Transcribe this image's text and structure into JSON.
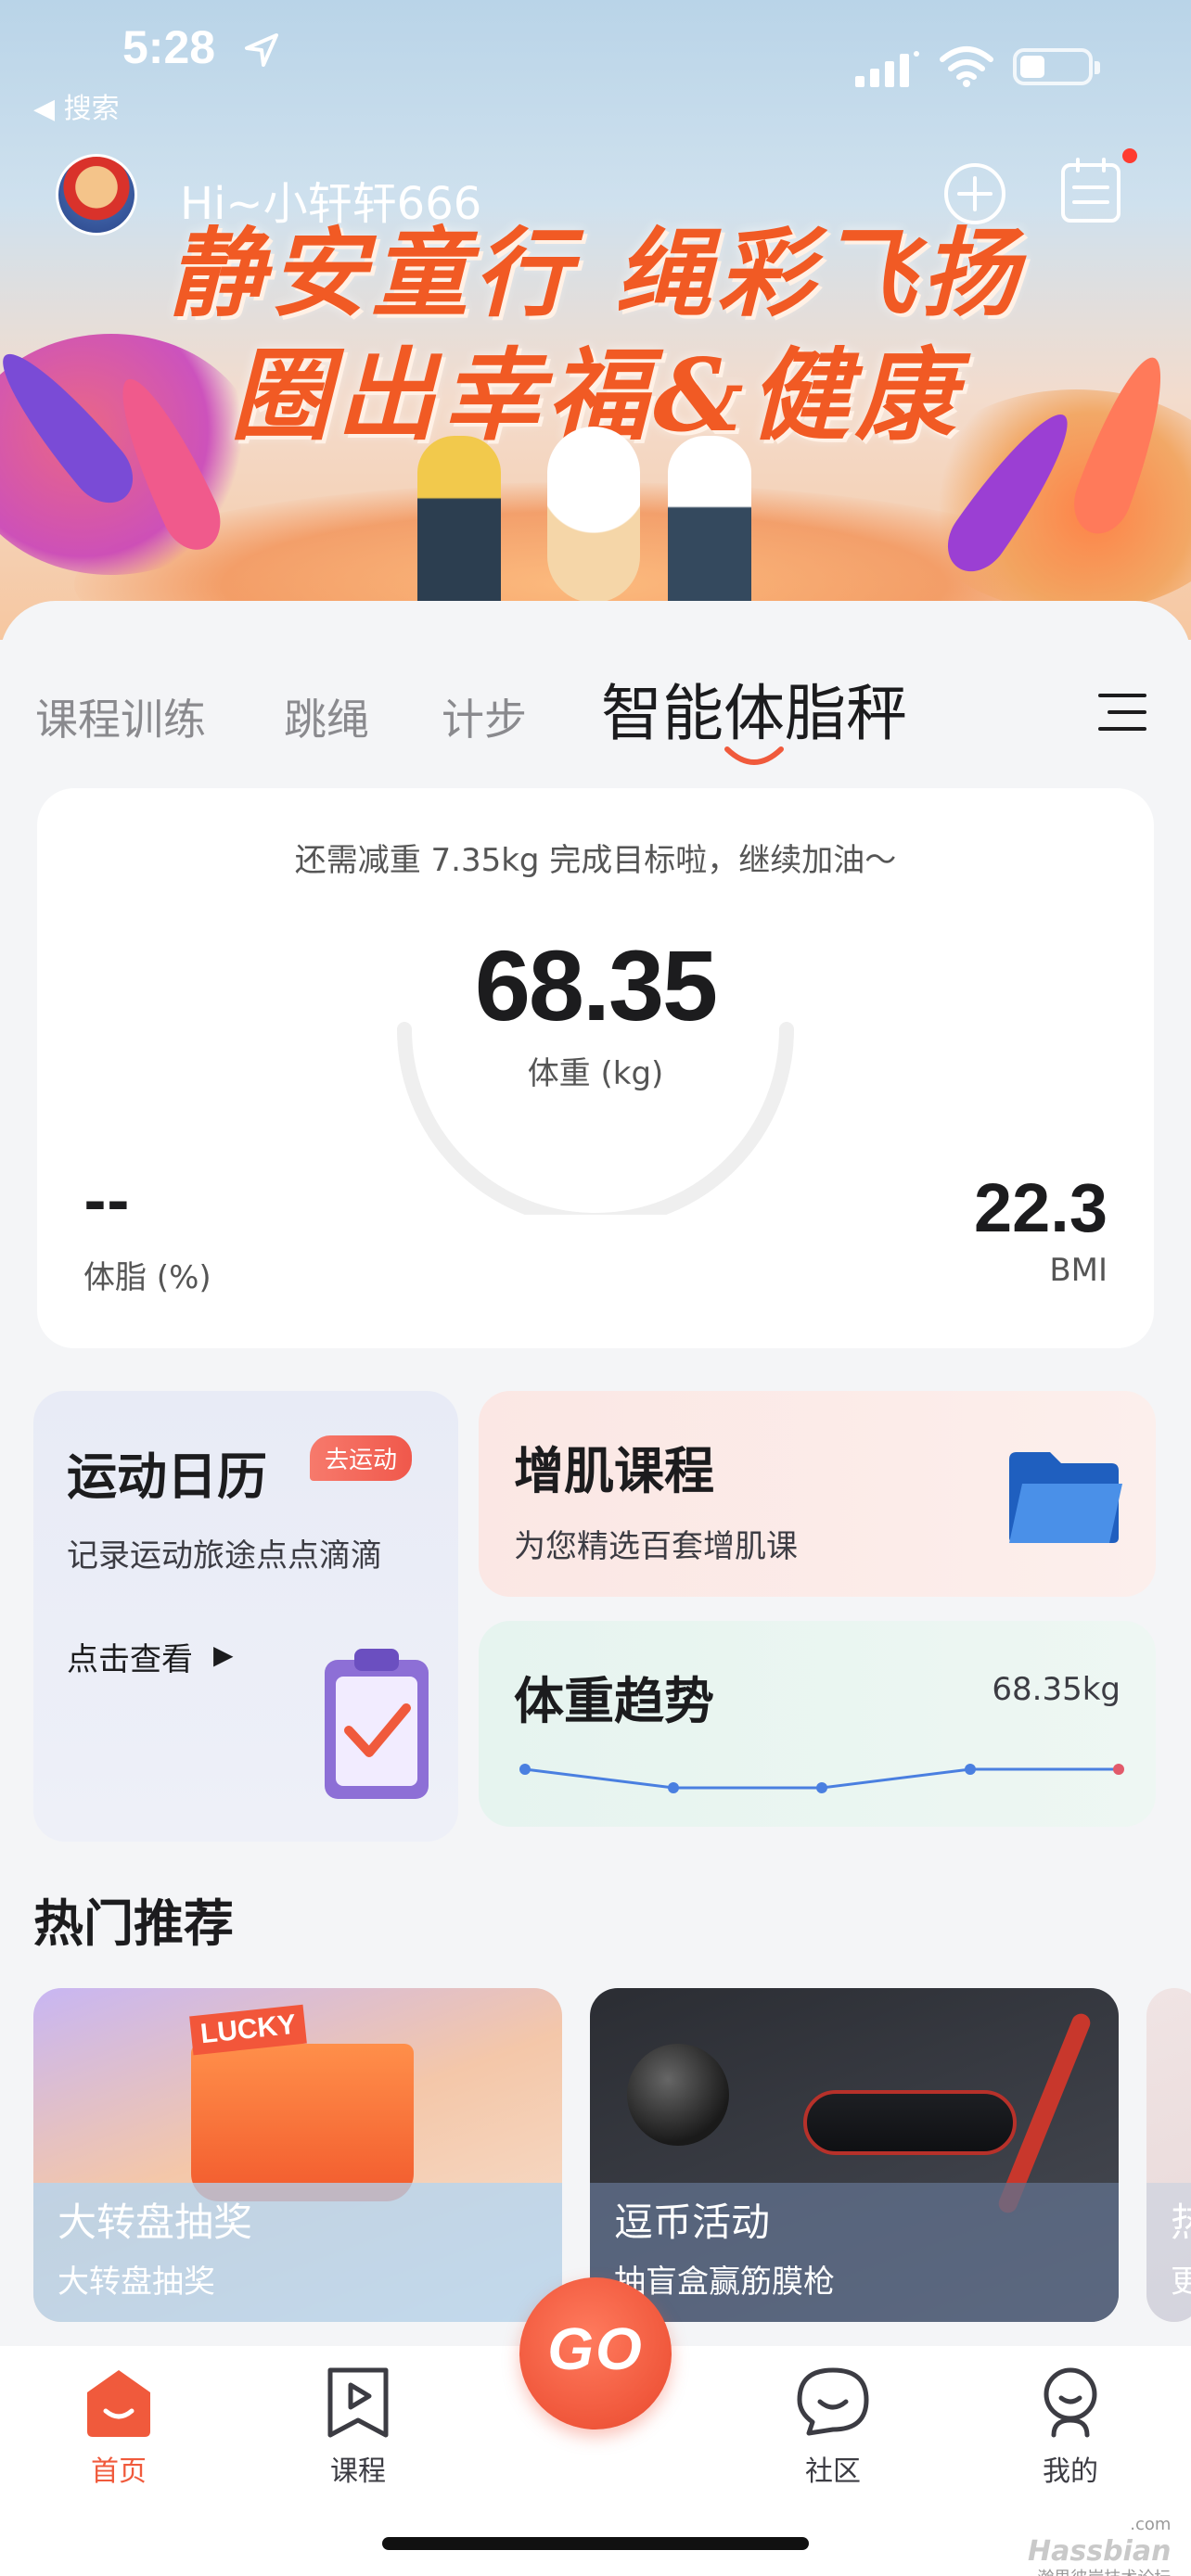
{
  "status_bar": {
    "time": "5:28",
    "back_label": "◀ 搜索"
  },
  "header": {
    "greeting": "Hi~小轩轩666"
  },
  "banner": {
    "line1": "静安童行 绳彩飞扬",
    "line2": "圈出幸福&健康"
  },
  "tabs": {
    "items": [
      {
        "label": "课程训练"
      },
      {
        "label": "跳绳"
      },
      {
        "label": "计步"
      },
      {
        "label": "智能体脂秤"
      }
    ],
    "active_index": 3
  },
  "weight_card": {
    "goal_text": "还需减重 7.35kg 完成目标啦，继续加油～",
    "weight_value": "68.35",
    "weight_label": "体重 (kg)",
    "fat_value": "--",
    "fat_label": "体脂 (%)",
    "bmi_value": "22.3",
    "bmi_label": "BMI"
  },
  "calendar_card": {
    "title": "运动日历",
    "badge": "去运动",
    "subtitle": "记录运动旅途点点滴滴",
    "link": "点击查看"
  },
  "muscle_card": {
    "title": "增肌课程",
    "subtitle": "为您精选百套增肌课"
  },
  "trend_card": {
    "title": "体重趋势",
    "value": "68.35kg"
  },
  "recommend": {
    "section_title": "热门推荐",
    "items": [
      {
        "title": "大转盘抽奖",
        "subtitle": "大转盘抽奖",
        "badge": "LUCKY"
      },
      {
        "title": "逗币活动",
        "subtitle": "抽盲盒赢筋膜枪"
      },
      {
        "title": "热",
        "subtitle": "更"
      }
    ]
  },
  "bottom_nav": {
    "items": [
      {
        "label": "首页"
      },
      {
        "label": "课程"
      },
      {
        "label": "社区"
      },
      {
        "label": "我的"
      }
    ],
    "go_label": "GO"
  },
  "watermark": {
    "brand": "Hassbian",
    "domain": ".com",
    "caption": "瀚思彼岸技术论坛"
  },
  "colors": {
    "accent": "#f05a3c",
    "trend_line": "#4a7fe0",
    "trend_last_point": "#e25a6a"
  },
  "chart_data": {
    "type": "line",
    "series": [
      {
        "values": [
          69.0,
          68.8,
          68.8,
          69.0,
          69.0
        ]
      }
    ],
    "last_point_highlight": true
  }
}
